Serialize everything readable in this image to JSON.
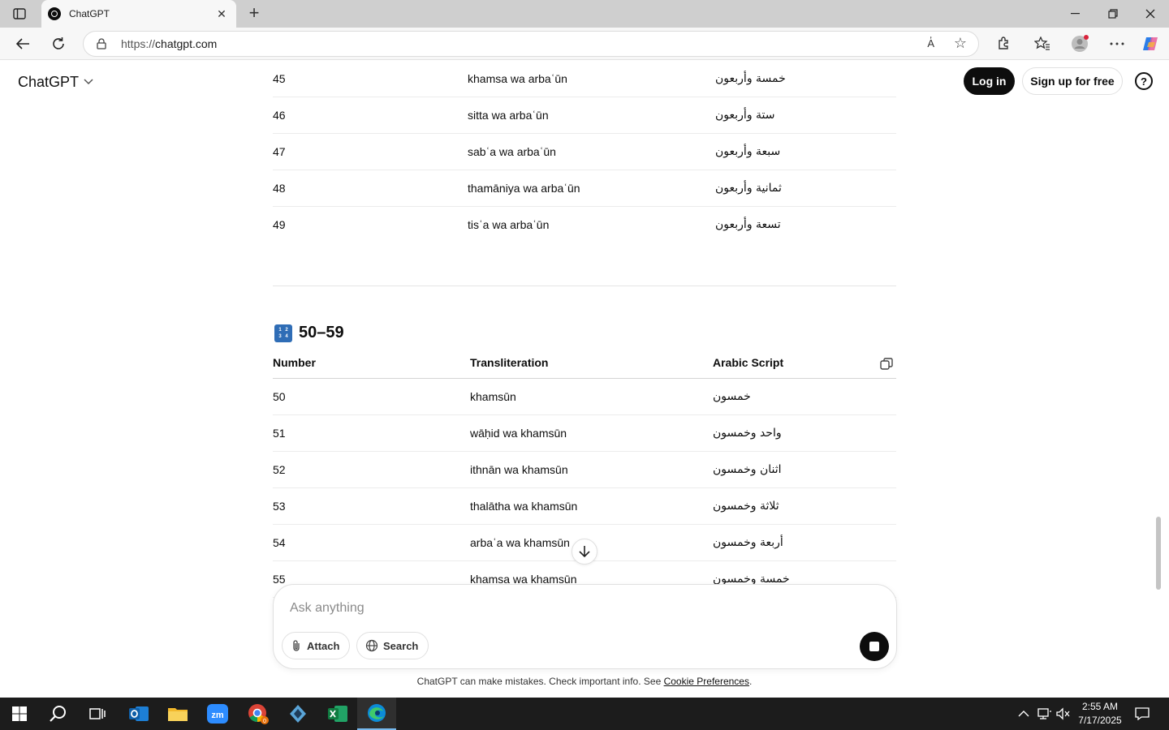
{
  "browser": {
    "tab_title": "ChatGPT",
    "url_prefix": "https://",
    "url_host": "chatgpt.com",
    "read_aloud_label": "A҆"
  },
  "header": {
    "brand": "ChatGPT",
    "login_label": "Log in",
    "signup_label": "Sign up for free",
    "help_label": "?"
  },
  "table_40s": {
    "rows": [
      {
        "number": "45",
        "translit": "khamsa wa arbaʿūn",
        "arabic": "خمسة وأربعون"
      },
      {
        "number": "46",
        "translit": "sitta wa arbaʿūn",
        "arabic": "ستة وأربعون"
      },
      {
        "number": "47",
        "translit": "sabʿa wa arbaʿūn",
        "arabic": "سبعة وأربعون"
      },
      {
        "number": "48",
        "translit": "thamāniya wa arbaʿūn",
        "arabic": "ثمانية وأربعون"
      },
      {
        "number": "49",
        "translit": "tisʿa wa arbaʿūn",
        "arabic": "تسعة وأربعون"
      }
    ]
  },
  "section_50s": {
    "icon_digits": [
      "1",
      "2",
      "3",
      "4"
    ],
    "title": "50–59",
    "headers": {
      "number": "Number",
      "translit": "Transliteration",
      "arabic": "Arabic Script"
    },
    "rows": [
      {
        "number": "50",
        "translit": "khamsūn",
        "arabic": "خمسون"
      },
      {
        "number": "51",
        "translit": "wāḥid wa khamsūn",
        "arabic": "واحد وخمسون"
      },
      {
        "number": "52",
        "translit": "ithnān wa khamsūn",
        "arabic": "اثنان وخمسون"
      },
      {
        "number": "53",
        "translit": "thalātha wa khamsūn",
        "arabic": "ثلاثة وخمسون"
      },
      {
        "number": "54",
        "translit": "arbaʿa wa khamsūn",
        "arabic": "أربعة وخمسون"
      },
      {
        "number": "55",
        "translit": "khamsa wa khamsūn",
        "arabic": "خمسة وخمسون"
      }
    ]
  },
  "composer": {
    "placeholder": "Ask anything",
    "attach_label": "Attach",
    "search_label": "Search"
  },
  "footer": {
    "disclaimer": "ChatGPT can make mistakes. Check important info. See ",
    "cookie_link": "Cookie Preferences",
    "period": "."
  },
  "taskbar": {
    "time": "2:55 AM",
    "date": "7/17/2025",
    "chrome_badge": "0"
  },
  "colors": {
    "accent_black": "#0d0d0d",
    "taskbar": "#1c1c1c",
    "tab_strip": "#cfcfcf"
  }
}
